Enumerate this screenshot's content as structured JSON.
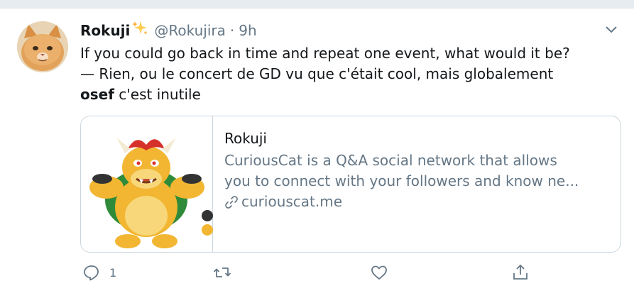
{
  "tweet": {
    "display_name": "Rokuji",
    "handle": "@Rokujira",
    "separator": "·",
    "time": "9h",
    "text_line_1": "If you could go back in time and repeat one event, what would it be?",
    "text_line_2": "— Rien, ou le concert de GD vu que c'était cool, mais globalement",
    "text_bold": "osef",
    "text_line_3_rest": " c'est inutile"
  },
  "card": {
    "title": "Rokuji",
    "description_line_1": "CuriousCat is a Q&A social network that allows",
    "description_line_2": "you to connect with your followers and know ne...",
    "url": "curiouscat.me"
  },
  "actions": {
    "reply_count": "1"
  },
  "colors": {
    "text_primary": "#14171a",
    "text_secondary": "#657786",
    "border": "#ccd6dd",
    "sparkle": "#ffcc4d"
  }
}
